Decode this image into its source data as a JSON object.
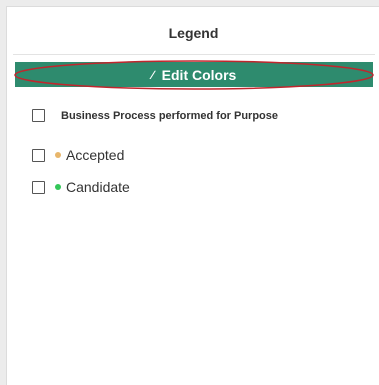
{
  "legend": {
    "title": "Legend",
    "edit_button_label": "Edit Colors",
    "edit_icon": "pencil-icon",
    "group": {
      "label": "Business Process performed for Purpose",
      "checked": false
    },
    "items": [
      {
        "label": "Accepted",
        "color": "#e8b66b",
        "checked": false
      },
      {
        "label": "Candidate",
        "color": "#34c759",
        "checked": false
      }
    ]
  },
  "annotation": {
    "highlight_color": "#c0262d"
  }
}
